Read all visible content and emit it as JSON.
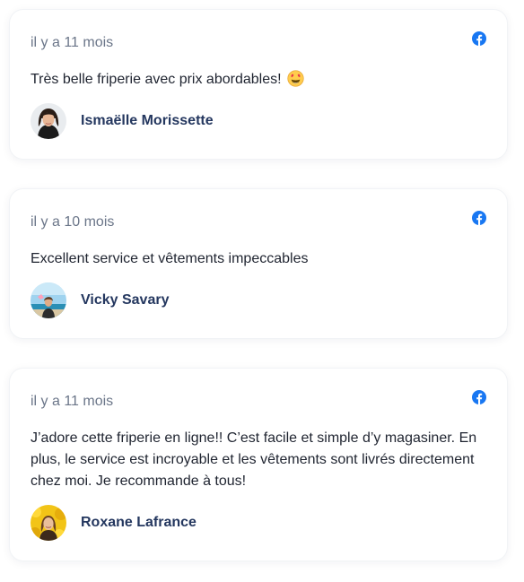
{
  "reviews": [
    {
      "time": "il y a 11 mois",
      "text": "Très belle friperie avec prix abordables!",
      "emoji": "heart-eyes-emoji",
      "author": "Ismaëlle Morissette",
      "source_icon": "facebook-icon"
    },
    {
      "time": "il y a 10 mois",
      "text": "Excellent service et vêtements impeccables",
      "author": "Vicky Savary",
      "source_icon": "facebook-icon"
    },
    {
      "time": "il y a 11 mois",
      "text": "J’adore cette friperie en ligne!! C’est facile et simple d’y magasiner. En plus, le service est incroyable et les vêtements sont livrés directement chez moi. Je recommande à tous!",
      "author": "Roxane Lafrance",
      "source_icon": "facebook-icon"
    }
  ],
  "colors": {
    "facebook": "#1877f2",
    "name": "#24375f",
    "time": "#6b7689",
    "text": "#1f2430"
  }
}
